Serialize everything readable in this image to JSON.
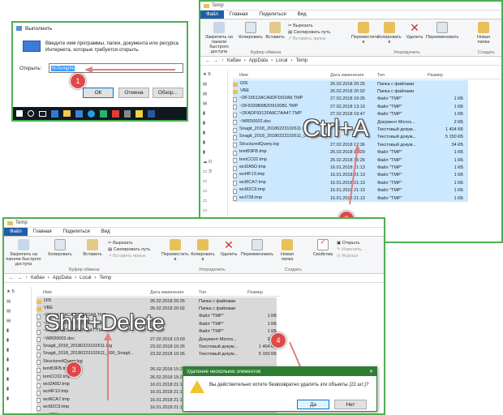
{
  "run_dialog": {
    "title": "Выполнить",
    "description": "Введите имя программы, папки, документа или ресурса Интернета, которые требуется открыть.",
    "open_label": "Открыть:",
    "input_value": "%Temp%",
    "ok_label": "ОК",
    "cancel_label": "Отмена",
    "browse_label": "Обзор..."
  },
  "explorer_top": {
    "title": "Temp",
    "tabs": [
      "Файл",
      "Главная",
      "Поделиться",
      "Вид"
    ],
    "ribbon": {
      "pin": "Закрепить на панели быстрого доступа",
      "copy": "Копировать",
      "paste": "Вставить",
      "cut": "Вырезать",
      "copy_path": "Скопировать путь",
      "paste_shortcut": "Вставить ярлык",
      "clipboard_group": "Буфер обмена",
      "move": "Переместить в",
      "copy_to": "Копировать в",
      "delete": "Удалить",
      "rename": "Переименовать",
      "organize_group": "Упорядочить",
      "new_folder": "Новая папка",
      "create_group": "Создать"
    },
    "breadcrumb": [
      "Кабан",
      "AppData",
      "Local",
      "Temp"
    ],
    "columns": [
      "Имя",
      "Дата изменения",
      "Тип",
      "Размер"
    ],
    "rows": [
      {
        "name": "OIS",
        "date": "26.02.2018 20:25",
        "type": "Папка с файлами",
        "size": "",
        "kind": "folder"
      },
      {
        "name": "VBE",
        "date": "26.02.2018 20:02",
        "type": "Папка с файлами",
        "size": "",
        "kind": "folder"
      },
      {
        "name": "~DF16513ACA9DFDD2A8.TMP",
        "date": "27.02.2018 19:35",
        "type": "Файл \"TMP\"",
        "size": "1 КБ",
        "kind": "file"
      },
      {
        "name": "~DF6039B6B2D9100B1.TMP",
        "date": "27.02.2018 13:10",
        "type": "Файл \"TMP\"",
        "size": "1 КБ",
        "kind": "file"
      },
      {
        "name": "~DFADF9312FA8C7AA47.TMP",
        "date": "27.02.2018 19:47",
        "type": "Файл \"TMP\"",
        "size": "1 КБ",
        "kind": "file"
      },
      {
        "name": "~WRD0002.doc",
        "date": "",
        "type": "Документ Micros...",
        "size": "2 КБ",
        "kind": "file"
      },
      {
        "name": "Snagit_2018_20180223102611.log",
        "date": "",
        "type": "Текстовый докум...",
        "size": "1 404 КБ",
        "kind": "file"
      },
      {
        "name": "Snagit_2018_20180223102611_000_Snagit...",
        "date": "",
        "type": "Текстовый докум...",
        "size": "5 150 КБ",
        "kind": "file"
      },
      {
        "name": "StructuredQuery.log",
        "date": "27.02.2018 12:36",
        "type": "Текстовый докум...",
        "size": "34 КБ",
        "kind": "file"
      },
      {
        "name": "temB3FB.tmp",
        "date": "26.02.2018 15:29",
        "type": "Файл \"TMP\"",
        "size": "1 КБ",
        "kind": "file"
      },
      {
        "name": "temCC02.tmp",
        "date": "26.02.2018 15:26",
        "type": "Файл \"TMP\"",
        "size": "1 КБ",
        "kind": "file"
      },
      {
        "name": "wct2A5D.tmp",
        "date": "16.01.2018 21:13",
        "type": "Файл \"TMP\"",
        "size": "1 КБ",
        "kind": "file"
      },
      {
        "name": "wct4F13.tmp",
        "date": "16.01.2018 21:13",
        "type": "Файл \"TMP\"",
        "size": "1 КБ",
        "kind": "file"
      },
      {
        "name": "wct6CA7.tmp",
        "date": "16.01.2018 21:13",
        "type": "Файл \"TMP\"",
        "size": "1 КБ",
        "kind": "file"
      },
      {
        "name": "wct92C9.tmp",
        "date": "16.01.2018 21:13",
        "type": "Файл \"TMP\"",
        "size": "1 КБ",
        "kind": "file"
      },
      {
        "name": "wct728.tmp",
        "date": "16.01.2018 21:13",
        "type": "Файл \"TMP\"",
        "size": "1 КБ",
        "kind": "file"
      }
    ],
    "overlay": "Ctrl+A"
  },
  "explorer_bottom": {
    "title": "Temp",
    "tabs": [
      "Файл",
      "Главная",
      "Поделиться",
      "Вид"
    ],
    "ribbon": {
      "pin": "Закрепить на панели быстрого доступа",
      "copy": "Копировать",
      "paste": "Вставить",
      "cut": "Вырезать",
      "copy_path": "Скопировать путь",
      "paste_shortcut": "Вставить ярлык",
      "clipboard_group": "Буфер обмена",
      "move": "Переместить в",
      "copy_to": "Копировать в",
      "delete": "Удалить",
      "rename": "Переименовать",
      "organize_group": "Упорядочить",
      "new_folder": "Новая папка",
      "create_group": "Создать",
      "properties": "Свойства",
      "open": "Открыть",
      "change": "Изменить",
      "journal": "Журнал"
    },
    "breadcrumb": [
      "Кабан",
      "AppData",
      "Local",
      "Temp"
    ],
    "columns": [
      "Имя",
      "Дата изменения",
      "Тип",
      "Размер"
    ],
    "rows": [
      {
        "name": "OIS",
        "date": "26.02.2018 20:25",
        "type": "Папка с файлами",
        "size": "",
        "kind": "folder"
      },
      {
        "name": "VBE",
        "date": "26.02.2018 20:02",
        "type": "Папка с файлами",
        "size": "",
        "kind": "folder"
      },
      {
        "name": "~DF16513ACA9DFDD2A8.TMP",
        "date": "",
        "type": "Файл \"TMP\"",
        "size": "1 КБ",
        "kind": "file"
      },
      {
        "name": "~DF6039B6B2D9100B1.TMP",
        "date": "",
        "type": "Файл \"TMP\"",
        "size": "1 КБ",
        "kind": "file"
      },
      {
        "name": "~DFADF9312FA8C7AA47.TMP",
        "date": "",
        "type": "Файл \"TMP\"",
        "size": "1 КБ",
        "kind": "file"
      },
      {
        "name": "~WRD0002.doc",
        "date": "27.02.2018 13:03",
        "type": "Документ Micros...",
        "size": "2 КБ",
        "kind": "file"
      },
      {
        "name": "Snagit_2018_20180223102611.log",
        "date": "23.02.2018 10:26",
        "type": "Текстовый докум...",
        "size": "1 404 КБ",
        "kind": "file"
      },
      {
        "name": "Snagit_2018_20180223102611_000_Snagit...",
        "date": "23.02.2018 10:26",
        "type": "Текстовый докум...",
        "size": "5 150 КБ",
        "kind": "file"
      },
      {
        "name": "StructuredQuery.log",
        "date": "",
        "type": "",
        "size": "",
        "kind": "file"
      },
      {
        "name": "temB3FB.tmp",
        "date": "26.02.2018 15:29",
        "type": "",
        "size": "",
        "kind": "file"
      },
      {
        "name": "temCC02.tmp",
        "date": "26.02.2018 15:26",
        "type": "",
        "size": "",
        "kind": "file"
      },
      {
        "name": "wct2A5D.tmp",
        "date": "16.01.2018 21:13",
        "type": "",
        "size": "",
        "kind": "file"
      },
      {
        "name": "wct4F13.tmp",
        "date": "16.01.2018 21:13",
        "type": "",
        "size": "",
        "kind": "file"
      },
      {
        "name": "wct6CA7.tmp",
        "date": "16.01.2018 21:13",
        "type": "",
        "size": "",
        "kind": "file"
      },
      {
        "name": "wct92C9.tmp",
        "date": "16.01.2018 21:13",
        "type": "",
        "size": "",
        "kind": "file"
      },
      {
        "name": "wct728.tmp",
        "date": "16.01.2018 21:13",
        "type": "",
        "size": "",
        "kind": "file"
      }
    ],
    "overlay": "Shift+Delete"
  },
  "delete_dialog": {
    "title": "Удаление нескольких элементов",
    "message": "Вы действительно хотите безвозвратно удалить эти объекты (22 шт.)?",
    "yes_label": "Да",
    "no_label": "Нет"
  },
  "steps": [
    "1",
    "2",
    "3",
    "4"
  ],
  "colors": {
    "accent": "#1f5fa8",
    "selection": "#cce8ff",
    "frame": "#4caf50",
    "step_circle": "#e04848",
    "arrow": "#e08080"
  }
}
